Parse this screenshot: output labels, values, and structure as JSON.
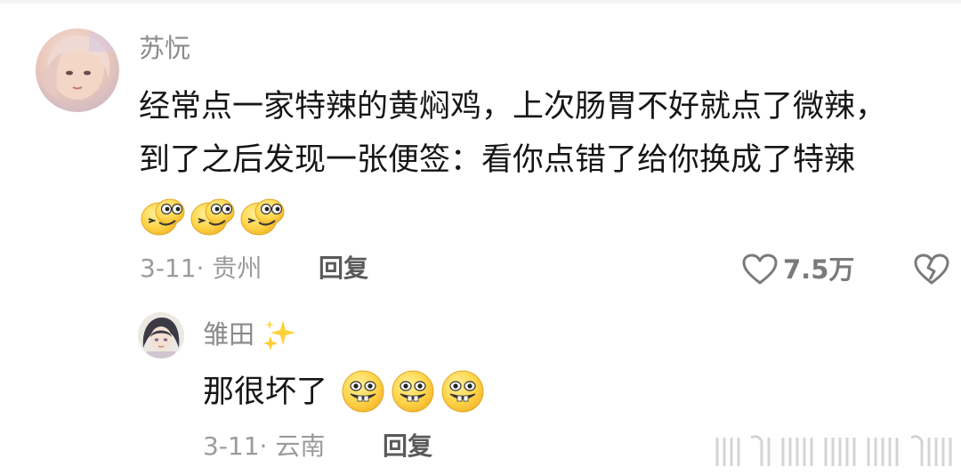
{
  "comments": [
    {
      "username": "苏忨",
      "text_line1": "经常点一家特辣的黄焖鸡，上次肠胃不好就点了微辣，",
      "text_line2": "到了之后发现一张便签：看你点错了给你换成了特辣",
      "emoji_icon": "smirk-face-icon",
      "emoji_count": 3,
      "date_location": "3-11· 贵州",
      "reply_label": "回复",
      "like_count": "7.5万"
    },
    {
      "username": "雏田",
      "username_emoji": "sparkles-icon",
      "text": "那很坏了",
      "emoji_icon": "grin-teeth-face-icon",
      "emoji_count": 3,
      "date_location": "3-11· 云南",
      "reply_label": "回复"
    }
  ],
  "icons": {
    "like": "heart-outline-icon",
    "dislike": "broken-heart-icon"
  },
  "colors": {
    "background": "#ffffff",
    "username": "#8a8a8a",
    "text": "#161616",
    "meta": "#9b9b9b",
    "reply": "#5a5a5a",
    "icon": "#7a7a7a",
    "emoji_yellow": "#ffd54a"
  }
}
